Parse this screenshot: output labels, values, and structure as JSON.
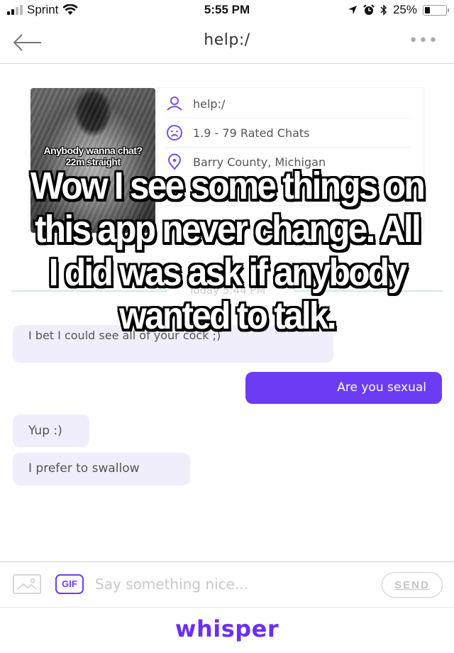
{
  "status_bar": {
    "carrier": "Sprint",
    "time": "5:55 PM",
    "battery": "25%",
    "battery_level": 0.25,
    "icons": [
      "signal-icon",
      "wifi-icon",
      "location-icon",
      "alarm-icon",
      "bluetooth-icon",
      "battery-icon"
    ]
  },
  "nav": {
    "title": "help:/",
    "back_icon": "arrow-left-icon",
    "more_icon": "more-horizontal-icon",
    "more_glyph": "•••"
  },
  "profile": {
    "photo_caption_line1": "Anybody wanna chat?",
    "photo_caption_line2": "22m straight",
    "rows": [
      {
        "icon": "user-icon",
        "text": "help:/"
      },
      {
        "icon": "sad-face-icon",
        "text": "1.9 - 79 Rated Chats"
      },
      {
        "icon": "location-pin-icon",
        "text": "Barry County, Michigan"
      }
    ]
  },
  "chat": {
    "date_label": "Today 5:44 PM",
    "messages": [
      {
        "direction": "incoming",
        "text": "I bet I could see all of your cock ;)"
      },
      {
        "direction": "outgoing",
        "text": "Are you sexual"
      },
      {
        "direction": "incoming",
        "text": "Yup :)"
      },
      {
        "direction": "incoming",
        "text": "I prefer to swallow"
      }
    ]
  },
  "composer": {
    "placeholder": "Say something nice...",
    "value": "",
    "gif_label": "GIF",
    "send_label": "SEND"
  },
  "footer": {
    "brand": "whisper"
  },
  "overlay": {
    "caption": "Wow I see some things on this app never change. All I did was ask if anybody wanted to talk."
  },
  "colors": {
    "accent": "#6b3cf4",
    "brand": "#6b2ff0",
    "incoming_bubble": "#f0eefb",
    "divider_line": "#c9efe3"
  }
}
